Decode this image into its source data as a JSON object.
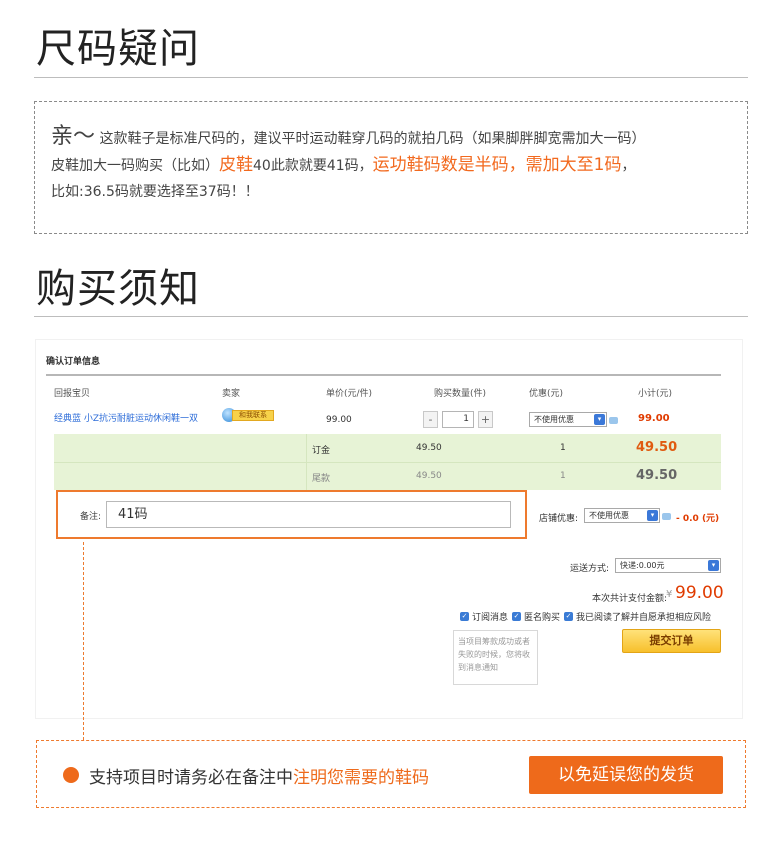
{
  "section1": {
    "title": "尺码疑问",
    "line1_lead": "亲～",
    "line1_text": " 这款鞋子是标准尺码的，建议平时运动鞋穿几码的就拍几码（如果脚胖脚宽需加大一码）",
    "line2_a": "皮鞋加大一码购买（比如）",
    "line2_b": "皮鞋",
    "line2_c": "40此款就要41码，",
    "line2_d": "运功鞋码数是半码，需加大至1码",
    "line2_e": "，",
    "line3": "比如:36.5码就要选择至37码！！"
  },
  "section2": {
    "title": "购买须知"
  },
  "order": {
    "title": "确认订单信息",
    "headers": {
      "item": "回报宝贝",
      "seller": "卖家",
      "price": "单价(元/件)",
      "qty": "购买数量(件)",
      "discount": "优惠(元)",
      "subtotal": "小计(元)"
    },
    "product_name": "经典蓝 小Z抗污耐脏运动休闲鞋一双",
    "seller_chat": "和我联系",
    "price": "99.00",
    "qty": "1",
    "qty_minus": "-",
    "qty_plus": "+",
    "discount_select": "不使用优惠",
    "subtotal": "99.00",
    "deposit": {
      "label": "订金",
      "amount": "49.50",
      "count": "1",
      "total": "49.50"
    },
    "balance": {
      "label": "尾款",
      "amount": "49.50",
      "count": "1",
      "total": "49.50"
    },
    "note_label": "备注:",
    "note_value": "41码",
    "shop_discount_label": "店铺优惠:",
    "shop_discount_select": "不使用优惠",
    "shop_discount_value": "- 0.0 (元)",
    "shipping_label": "运送方式:",
    "shipping_select": "快递:0.00元",
    "pay_label": "本次共计支付金额:",
    "pay_currency": "¥",
    "pay_amount": "99.00",
    "opt_subscribe": "订阅消息",
    "opt_anonymous": "匿名购买",
    "opt_agree": "我已阅读了解并自愿承担相应风险",
    "tip": "当项目筹款成功或者失败的时候，您将收到消息通知",
    "submit": "提交订单"
  },
  "bottom": {
    "text_a": "支持项目时请务必在备注中",
    "text_b": "注明您需要的鞋码",
    "button": "以免延误您的发货"
  },
  "colors": {
    "accent": "#ee6a1b",
    "link": "#2b6bd8",
    "green_band": "#e7f3d6"
  }
}
